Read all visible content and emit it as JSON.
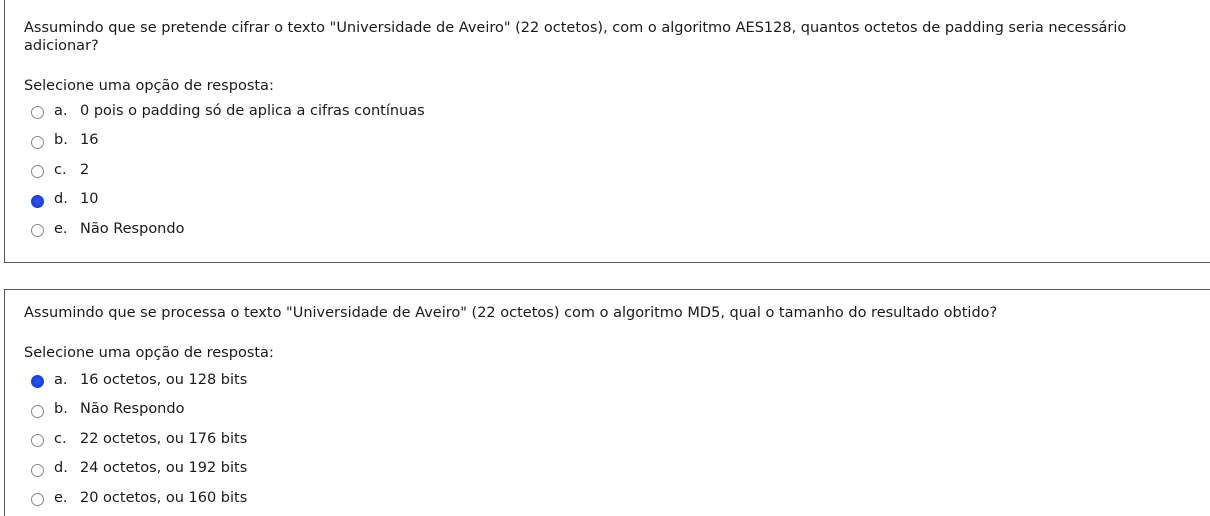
{
  "questions": [
    {
      "text": "Assumindo que se pretende cifrar o texto \"Universidade de Aveiro\" (22 octetos), com o algoritmo AES128, quantos octetos de padding seria necessário adicionar?",
      "prompt": "Selecione uma opção de resposta:",
      "selected": "d",
      "options": [
        {
          "letter": "a.",
          "label": "0 pois o padding só de aplica a cifras contínuas"
        },
        {
          "letter": "b.",
          "label": "16"
        },
        {
          "letter": "c.",
          "label": "2"
        },
        {
          "letter": "d.",
          "label": "10"
        },
        {
          "letter": "e.",
          "label": "Não Respondo"
        }
      ]
    },
    {
      "text": "Assumindo que se processa o texto \"Universidade de Aveiro\" (22 octetos) com o algoritmo MD5, qual o tamanho do resultado obtido?",
      "prompt": "Selecione uma opção de resposta:",
      "selected": "a",
      "options": [
        {
          "letter": "a.",
          "label": "16 octetos, ou 128 bits"
        },
        {
          "letter": "b.",
          "label": "Não Respondo"
        },
        {
          "letter": "c.",
          "label": "22 octetos, ou 176 bits"
        },
        {
          "letter": "d.",
          "label": "24 octetos, ou 192 bits"
        },
        {
          "letter": "e.",
          "label": "20 octetos, ou 160 bits"
        }
      ]
    }
  ]
}
